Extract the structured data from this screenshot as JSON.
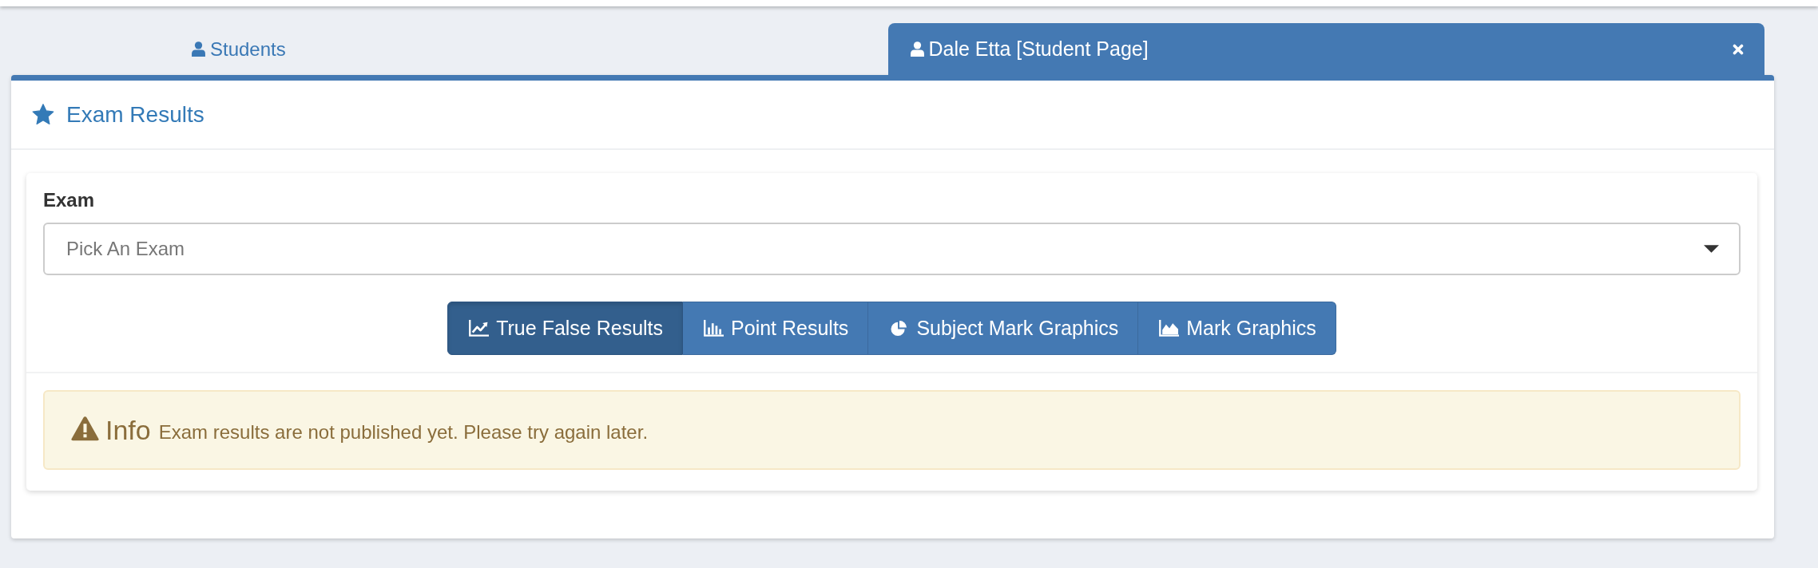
{
  "tabs": [
    {
      "label": "Students",
      "selected": false,
      "closable": false
    },
    {
      "label": "Dale Etta [Student Page]",
      "selected": true,
      "closable": true
    }
  ],
  "panel": {
    "title": "Exam Results"
  },
  "exam_field": {
    "label": "Exam",
    "placeholder": "Pick An Exam"
  },
  "result_buttons": [
    {
      "label": "True False Results",
      "selected": true
    },
    {
      "label": "Point Results",
      "selected": false
    },
    {
      "label": "Subject Mark Graphics",
      "selected": false
    },
    {
      "label": "Mark Graphics",
      "selected": false
    }
  ],
  "alert": {
    "title": "Info",
    "message": "Exam results are not published yet. Please try again later."
  }
}
